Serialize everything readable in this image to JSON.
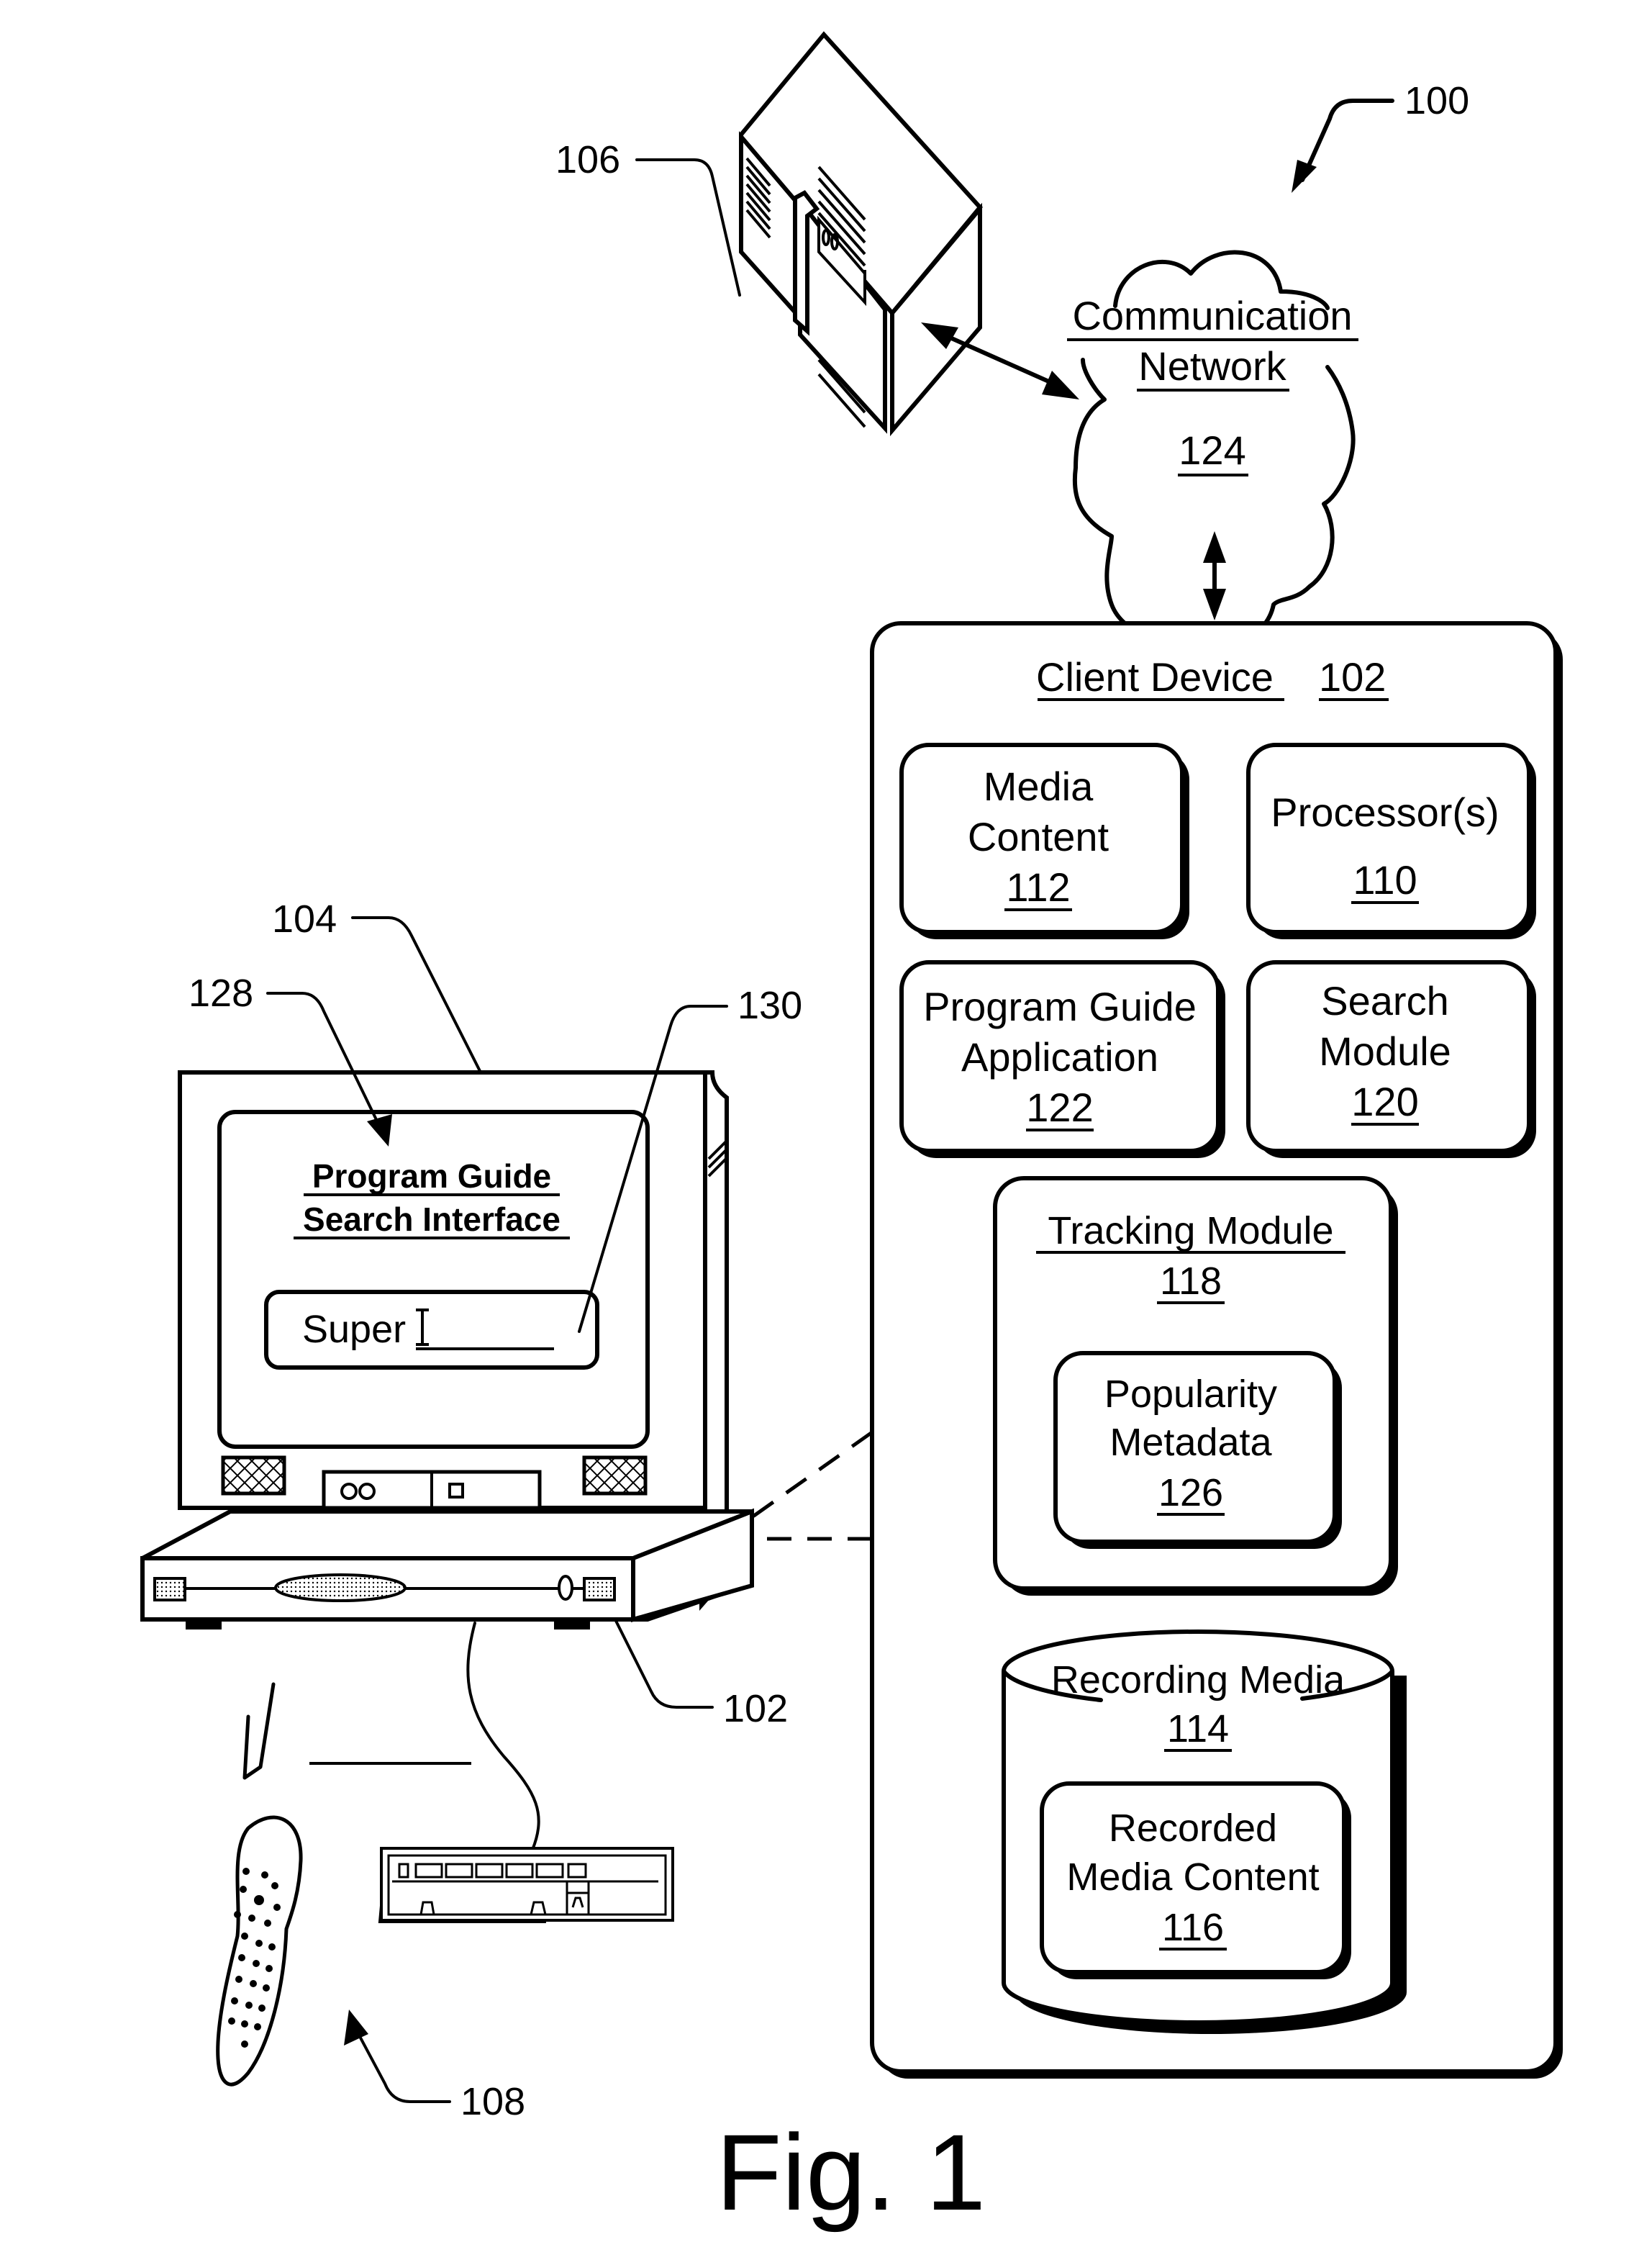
{
  "figure": {
    "caption": "Fig. 1",
    "system_ref": "100"
  },
  "server": {
    "ref": "106",
    "icon": "server-tower-icon"
  },
  "network": {
    "line1": "Communication",
    "line2": "Network",
    "ref": "124",
    "icon": "cloud-icon"
  },
  "client_device": {
    "title": "Client Device",
    "ref": "102",
    "modules": [
      {
        "lines": [
          "Media",
          "Content"
        ],
        "ref": "112"
      },
      {
        "lines": [
          "Processor(s)"
        ],
        "ref": "110"
      },
      {
        "lines": [
          "Program Guide",
          "Application"
        ],
        "ref": "122"
      },
      {
        "lines": [
          "Search",
          "Module"
        ],
        "ref": "120"
      }
    ],
    "tracking_module": {
      "title": "Tracking Module",
      "ref": "118",
      "popularity": {
        "lines": [
          "Popularity",
          "Metadata"
        ],
        "ref": "126"
      }
    },
    "recording_media": {
      "title": "Recording Media",
      "ref": "114",
      "recorded": {
        "lines": [
          "Recorded",
          "Media Content"
        ],
        "ref": "116"
      }
    }
  },
  "television": {
    "ref": "104",
    "screen_ref": "128",
    "screen_title_line1": "Program Guide",
    "screen_title_line2": "Search Interface",
    "search_field": {
      "ref": "130",
      "value": "Super",
      "cursor": "I-beam"
    }
  },
  "set_top_box": {
    "ref": "102"
  },
  "remote": {
    "ref": "108",
    "icon": "remote-control-icon"
  },
  "keyboard": {
    "icon": "keyboard-icon"
  }
}
